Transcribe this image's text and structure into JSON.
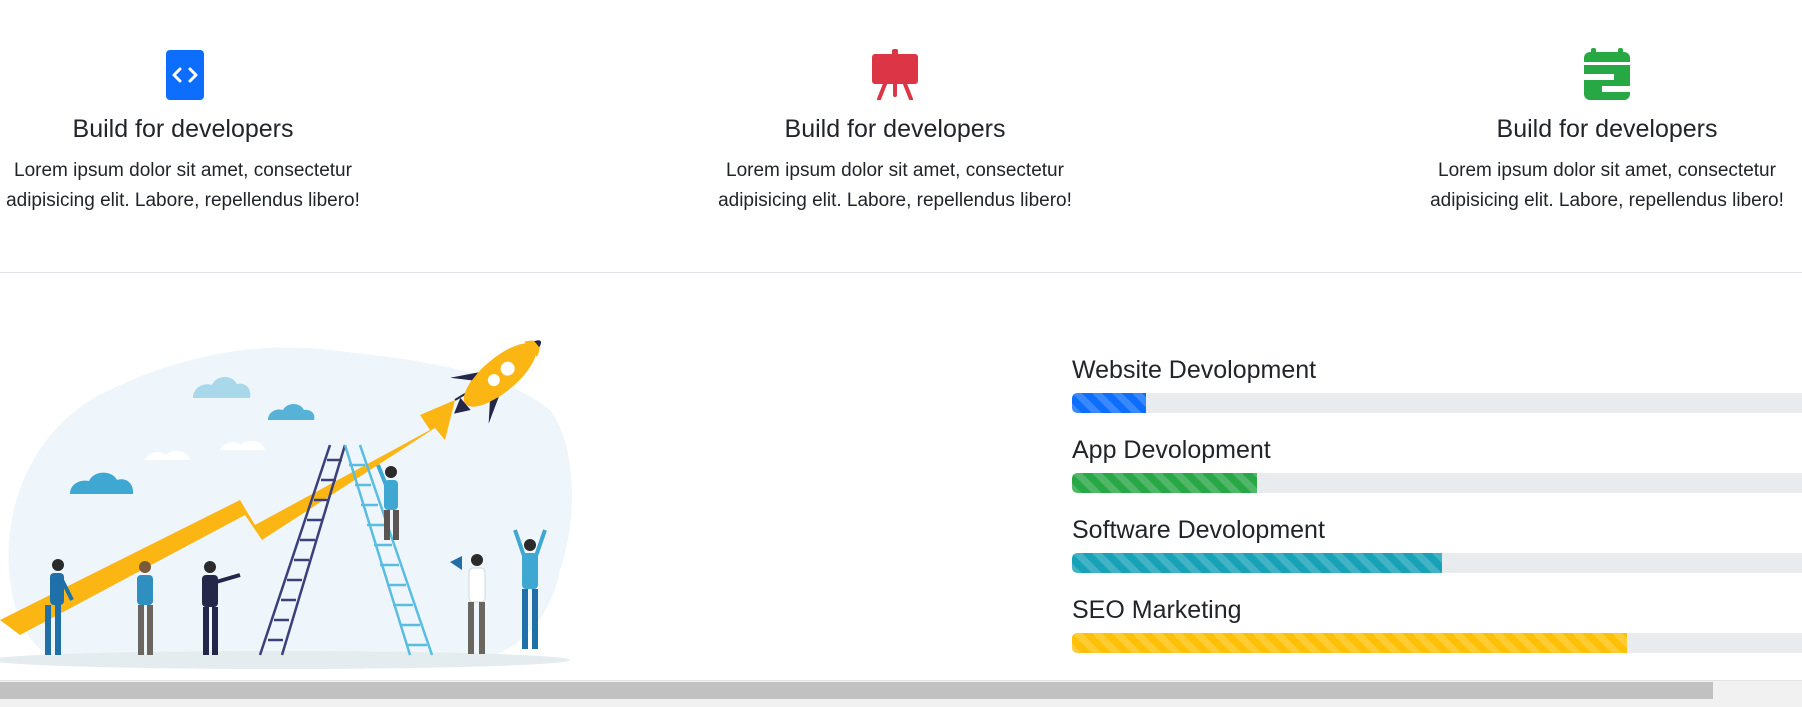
{
  "features": [
    {
      "icon": "code-icon",
      "icon_color": "#0d6efd",
      "title": "Build for developers",
      "text": "Lorem ipsum dolor sit amet, consectetur adipisicing elit. Labore, repellendus libero!"
    },
    {
      "icon": "presentation-easel-icon",
      "icon_color": "#dc3545",
      "title": "Build for developers",
      "text": "Lorem ipsum dolor sit amet, consectetur adipisicing elit. Labore, repellendus libero!"
    },
    {
      "icon": "calendar-icon",
      "icon_color": "#28a745",
      "title": "Build for developers",
      "text": "Lorem ipsum dolor sit amet, consectetur adipisicing elit. Labore, repellendus libero!"
    }
  ],
  "illustration": {
    "name": "team-growth-rocket-illustration"
  },
  "skills": [
    {
      "label": "Website Devolopment",
      "percent": 10,
      "color": "#0d6efd"
    },
    {
      "label": "App Devolopment",
      "percent": 25,
      "color": "#28a745"
    },
    {
      "label": "Software Devolopment",
      "percent": 50,
      "color": "#17a2b8"
    },
    {
      "label": "SEO Marketing",
      "percent": 75,
      "color": "#ffc107"
    }
  ]
}
